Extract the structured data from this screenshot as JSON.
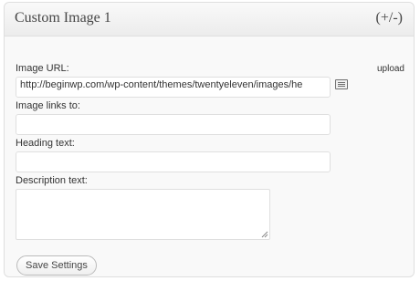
{
  "widget": {
    "title": "Custom Image 1",
    "toggle_label": "(+/-)"
  },
  "form": {
    "image_url_label": "Image URL:",
    "upload_label": "upload",
    "image_url_value": "http://beginwp.com/wp-content/themes/twentyeleven/images/he",
    "image_link_label": "Image links to:",
    "image_link_value": "",
    "heading_label": "Heading text:",
    "heading_value": "",
    "description_label": "Description text:",
    "description_value": "",
    "save_label": "Save Settings"
  },
  "icons": {
    "media": "media-library-icon",
    "resize": "resize-grip-icon"
  },
  "colors": {
    "border": "#dfdfdf",
    "header_bg": "#ececec",
    "text": "#333333"
  }
}
